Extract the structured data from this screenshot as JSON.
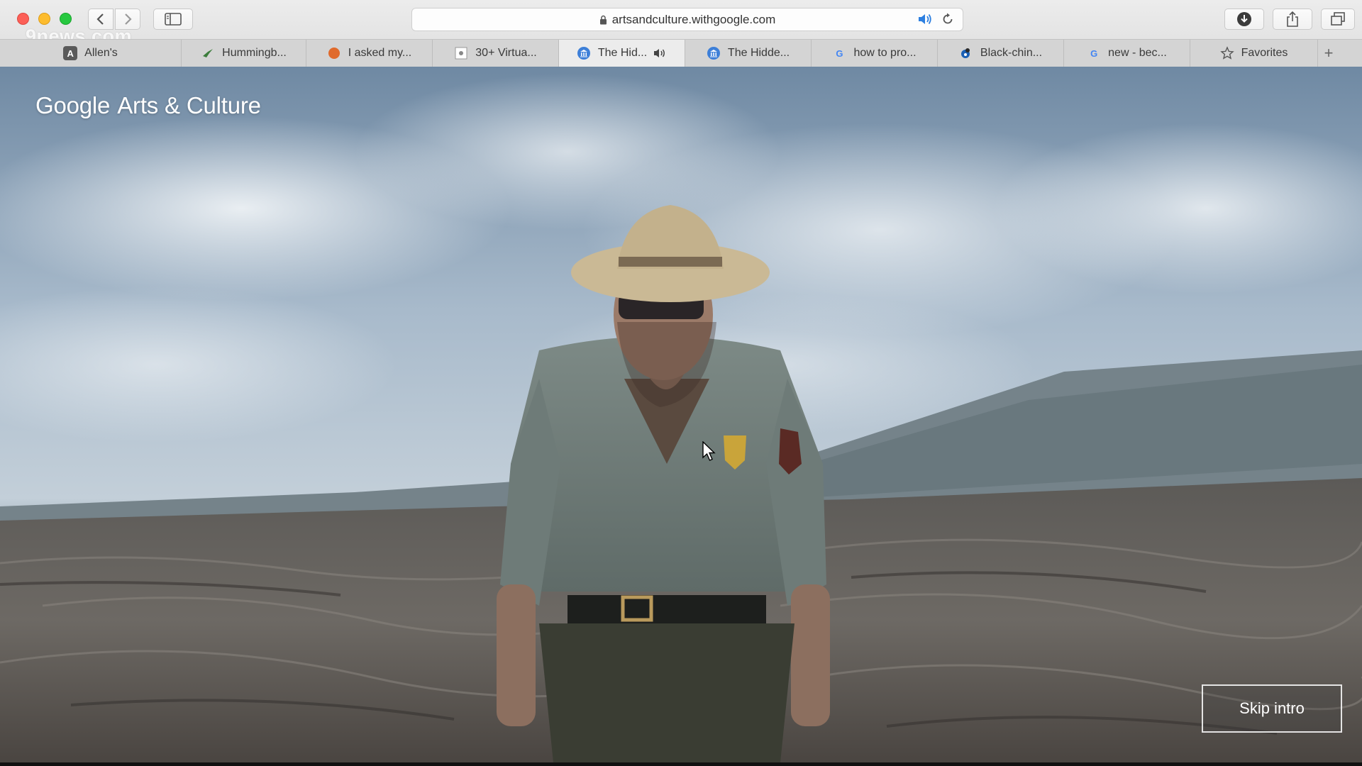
{
  "browser": {
    "url": "artsandculture.withgoogle.com",
    "watermark": "9news.com",
    "tabs": [
      {
        "label": "Allen's",
        "favicon": "A",
        "favicon_color": "#5a5a5a",
        "width": 110,
        "offset": 145
      },
      {
        "label": "Hummingb...",
        "favicon": "hummingbird-icon",
        "favicon_color": "#3c7d3c",
        "width": 178
      },
      {
        "label": "I asked my...",
        "favicon": "orange-dot-icon",
        "favicon_color": "#e06a2c",
        "width": 178
      },
      {
        "label": "30+ Virtua...",
        "favicon": "page-icon",
        "favicon_color": "#888888",
        "width": 178
      },
      {
        "label": "The Hid...",
        "favicon": "museum-icon",
        "favicon_color": "#3d7fd8",
        "width": 178,
        "active": true,
        "audio": true
      },
      {
        "label": "The Hidde...",
        "favicon": "museum-icon",
        "favicon_color": "#3d7fd8",
        "width": 178
      },
      {
        "label": "how to pro...",
        "favicon": "G",
        "favicon_color": "#4285f4",
        "width": 178
      },
      {
        "label": "Black-chin...",
        "favicon": "bird-icon",
        "favicon_color": "#1a5fb4",
        "width": 178
      },
      {
        "label": "new - bec...",
        "favicon": "G",
        "favicon_color": "#4285f4",
        "width": 178
      },
      {
        "label": "Favorites",
        "favicon": "star-icon",
        "favicon_color": "#555555",
        "width": 150
      }
    ]
  },
  "page": {
    "brand_google": "Google",
    "brand_rest": "Arts & Culture",
    "skip_intro": "Skip intro"
  }
}
